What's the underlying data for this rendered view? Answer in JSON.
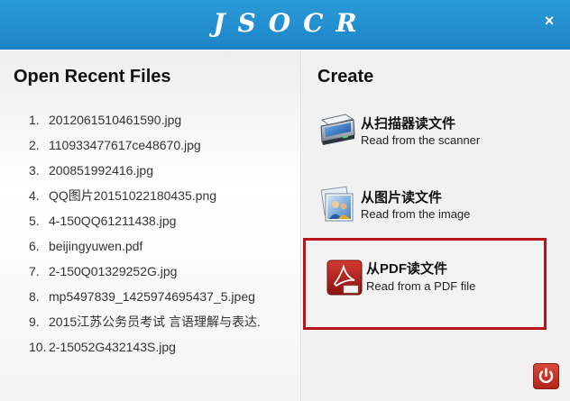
{
  "app": {
    "title": "JSOCR",
    "close_label": "×"
  },
  "recent": {
    "title": "Open Recent Files",
    "items": [
      {
        "num": "1.",
        "name": "2012061510461590.jpg"
      },
      {
        "num": "2.",
        "name": "110933477617ce48670.jpg"
      },
      {
        "num": "3.",
        "name": "200851992416.jpg"
      },
      {
        "num": "4.",
        "name": "QQ图片20151022180435.png"
      },
      {
        "num": "5.",
        "name": "4-150QQ61211438.jpg"
      },
      {
        "num": "6.",
        "name": "beijingyuwen.pdf"
      },
      {
        "num": "7.",
        "name": "2-150Q01329252G.jpg"
      },
      {
        "num": "8.",
        "name": "mp5497839_1425974695437_5.jpeg"
      },
      {
        "num": "9.",
        "name": "2015江苏公务员考试 言语理解与表达."
      },
      {
        "num": "10.",
        "name": "2-15052G432143S.jpg"
      }
    ]
  },
  "create": {
    "title": "Create",
    "scanner": {
      "cn": "从扫描器读文件",
      "en": "Read from the scanner",
      "icon": "scanner-icon"
    },
    "image": {
      "cn": "从图片读文件",
      "en": "Read from the image",
      "icon": "picture-icon"
    },
    "pdf": {
      "cn": "从PDF读文件",
      "en": "Read from a PDF file",
      "icon": "pdf-icon"
    }
  },
  "footer": {
    "power_icon": "power-icon"
  },
  "colors": {
    "titlebar": "#2196d6",
    "highlight_border": "#b8141c",
    "power": "#c9302c"
  }
}
